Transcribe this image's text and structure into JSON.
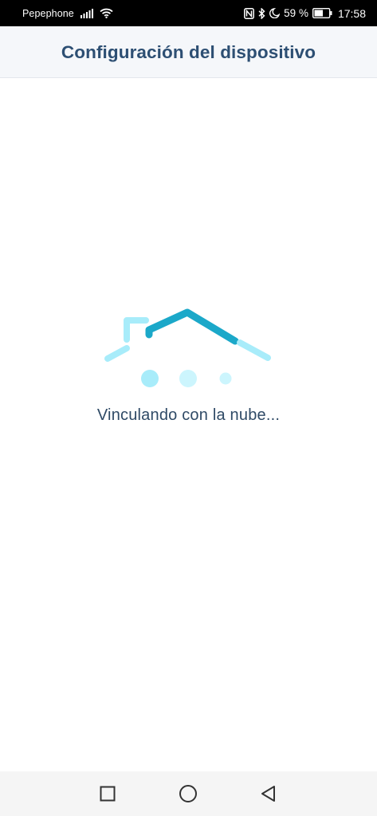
{
  "status_bar": {
    "carrier": "Pepephone",
    "battery_percent": "59 %",
    "time": "17:58",
    "icons": [
      "signal-icon",
      "wifi-icon",
      "nfc-icon",
      "bluetooth-icon",
      "do-not-disturb-moon-icon",
      "battery-icon"
    ]
  },
  "header": {
    "title": "Configuración del dispositivo"
  },
  "loading": {
    "icon": "house-loading-icon",
    "message": "Vinculando con la nube..."
  },
  "nav_bar": {
    "buttons": [
      "recent-apps",
      "home",
      "back"
    ]
  },
  "colors": {
    "title": "#2d4f73",
    "accent": "#1ba8c9",
    "accent_light": "#a8ecfa",
    "nav_bg": "#f5f5f5",
    "header_bg": "#f5f7fa"
  }
}
